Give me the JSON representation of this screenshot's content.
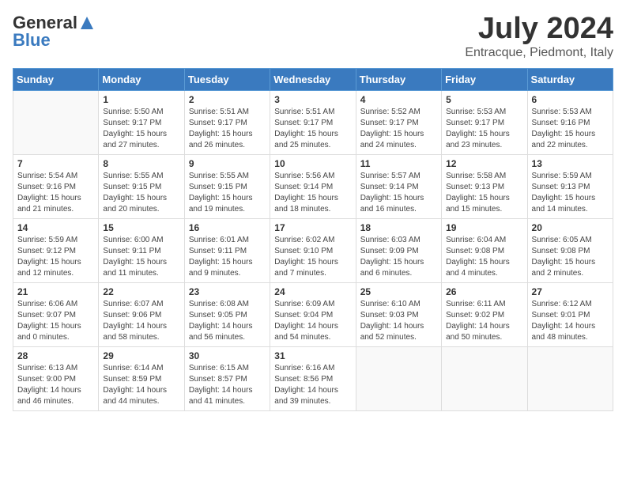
{
  "logo": {
    "general": "General",
    "blue": "Blue"
  },
  "title": "July 2024",
  "location": "Entracque, Piedmont, Italy",
  "days_of_week": [
    "Sunday",
    "Monday",
    "Tuesday",
    "Wednesday",
    "Thursday",
    "Friday",
    "Saturday"
  ],
  "weeks": [
    [
      {
        "day": "",
        "info": ""
      },
      {
        "day": "1",
        "info": "Sunrise: 5:50 AM\nSunset: 9:17 PM\nDaylight: 15 hours\nand 27 minutes."
      },
      {
        "day": "2",
        "info": "Sunrise: 5:51 AM\nSunset: 9:17 PM\nDaylight: 15 hours\nand 26 minutes."
      },
      {
        "day": "3",
        "info": "Sunrise: 5:51 AM\nSunset: 9:17 PM\nDaylight: 15 hours\nand 25 minutes."
      },
      {
        "day": "4",
        "info": "Sunrise: 5:52 AM\nSunset: 9:17 PM\nDaylight: 15 hours\nand 24 minutes."
      },
      {
        "day": "5",
        "info": "Sunrise: 5:53 AM\nSunset: 9:17 PM\nDaylight: 15 hours\nand 23 minutes."
      },
      {
        "day": "6",
        "info": "Sunrise: 5:53 AM\nSunset: 9:16 PM\nDaylight: 15 hours\nand 22 minutes."
      }
    ],
    [
      {
        "day": "7",
        "info": "Sunrise: 5:54 AM\nSunset: 9:16 PM\nDaylight: 15 hours\nand 21 minutes."
      },
      {
        "day": "8",
        "info": "Sunrise: 5:55 AM\nSunset: 9:15 PM\nDaylight: 15 hours\nand 20 minutes."
      },
      {
        "day": "9",
        "info": "Sunrise: 5:55 AM\nSunset: 9:15 PM\nDaylight: 15 hours\nand 19 minutes."
      },
      {
        "day": "10",
        "info": "Sunrise: 5:56 AM\nSunset: 9:14 PM\nDaylight: 15 hours\nand 18 minutes."
      },
      {
        "day": "11",
        "info": "Sunrise: 5:57 AM\nSunset: 9:14 PM\nDaylight: 15 hours\nand 16 minutes."
      },
      {
        "day": "12",
        "info": "Sunrise: 5:58 AM\nSunset: 9:13 PM\nDaylight: 15 hours\nand 15 minutes."
      },
      {
        "day": "13",
        "info": "Sunrise: 5:59 AM\nSunset: 9:13 PM\nDaylight: 15 hours\nand 14 minutes."
      }
    ],
    [
      {
        "day": "14",
        "info": "Sunrise: 5:59 AM\nSunset: 9:12 PM\nDaylight: 15 hours\nand 12 minutes."
      },
      {
        "day": "15",
        "info": "Sunrise: 6:00 AM\nSunset: 9:11 PM\nDaylight: 15 hours\nand 11 minutes."
      },
      {
        "day": "16",
        "info": "Sunrise: 6:01 AM\nSunset: 9:11 PM\nDaylight: 15 hours\nand 9 minutes."
      },
      {
        "day": "17",
        "info": "Sunrise: 6:02 AM\nSunset: 9:10 PM\nDaylight: 15 hours\nand 7 minutes."
      },
      {
        "day": "18",
        "info": "Sunrise: 6:03 AM\nSunset: 9:09 PM\nDaylight: 15 hours\nand 6 minutes."
      },
      {
        "day": "19",
        "info": "Sunrise: 6:04 AM\nSunset: 9:08 PM\nDaylight: 15 hours\nand 4 minutes."
      },
      {
        "day": "20",
        "info": "Sunrise: 6:05 AM\nSunset: 9:08 PM\nDaylight: 15 hours\nand 2 minutes."
      }
    ],
    [
      {
        "day": "21",
        "info": "Sunrise: 6:06 AM\nSunset: 9:07 PM\nDaylight: 15 hours\nand 0 minutes."
      },
      {
        "day": "22",
        "info": "Sunrise: 6:07 AM\nSunset: 9:06 PM\nDaylight: 14 hours\nand 58 minutes."
      },
      {
        "day": "23",
        "info": "Sunrise: 6:08 AM\nSunset: 9:05 PM\nDaylight: 14 hours\nand 56 minutes."
      },
      {
        "day": "24",
        "info": "Sunrise: 6:09 AM\nSunset: 9:04 PM\nDaylight: 14 hours\nand 54 minutes."
      },
      {
        "day": "25",
        "info": "Sunrise: 6:10 AM\nSunset: 9:03 PM\nDaylight: 14 hours\nand 52 minutes."
      },
      {
        "day": "26",
        "info": "Sunrise: 6:11 AM\nSunset: 9:02 PM\nDaylight: 14 hours\nand 50 minutes."
      },
      {
        "day": "27",
        "info": "Sunrise: 6:12 AM\nSunset: 9:01 PM\nDaylight: 14 hours\nand 48 minutes."
      }
    ],
    [
      {
        "day": "28",
        "info": "Sunrise: 6:13 AM\nSunset: 9:00 PM\nDaylight: 14 hours\nand 46 minutes."
      },
      {
        "day": "29",
        "info": "Sunrise: 6:14 AM\nSunset: 8:59 PM\nDaylight: 14 hours\nand 44 minutes."
      },
      {
        "day": "30",
        "info": "Sunrise: 6:15 AM\nSunset: 8:57 PM\nDaylight: 14 hours\nand 41 minutes."
      },
      {
        "day": "31",
        "info": "Sunrise: 6:16 AM\nSunset: 8:56 PM\nDaylight: 14 hours\nand 39 minutes."
      },
      {
        "day": "",
        "info": ""
      },
      {
        "day": "",
        "info": ""
      },
      {
        "day": "",
        "info": ""
      }
    ]
  ]
}
